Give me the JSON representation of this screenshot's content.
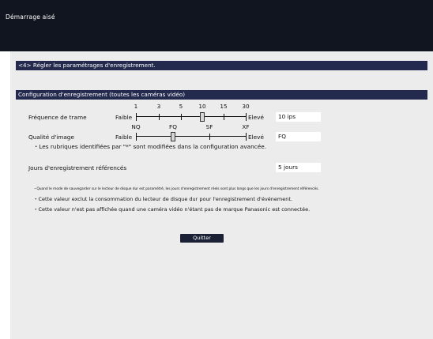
{
  "window": {
    "title": "Démarrage aisé"
  },
  "step": {
    "title": "<4> Régler les paramétrages d'enregistrement."
  },
  "section": {
    "title": "Configuration d'enregistrement (toutes les caméras vidéo)"
  },
  "frame_rate": {
    "label": "Fréquence de trame",
    "min_label": "Faible",
    "max_label": "Elevé",
    "scale": [
      "1",
      "3",
      "5",
      "10",
      "15",
      "30"
    ],
    "selected": "10",
    "value": "10 ips"
  },
  "image_quality": {
    "label": "Qualité d'image",
    "min_label": "Faible",
    "max_label": "Elevé",
    "scale": [
      "NQ",
      "FQ",
      "SF",
      "XF"
    ],
    "selected": "FQ",
    "value": "FQ"
  },
  "notes": {
    "advanced": "・Les rubriques identifiées par \"*\" sont modifiées dans la configuration avancée.",
    "footnote1": "・Quand le mode de sauvegarder sur le lecteur de disque dur est paramétré, les jours d'enregistrement réels sont plus longs que les jours d'enregistrement référencés.",
    "footnote2": "・Cette valeur exclut la consommation du lecteur de disque dur pour l'enregistrement d'événement.",
    "footnote3": "・Cette valeur n'est pas affichée quand une caméra vidéo n'étant pas de marque Panasonic est connectée."
  },
  "recording_days": {
    "label": "Jours d'enregistrement référencés",
    "value": "5 jours"
  },
  "buttons": {
    "quit": "Quitter"
  }
}
